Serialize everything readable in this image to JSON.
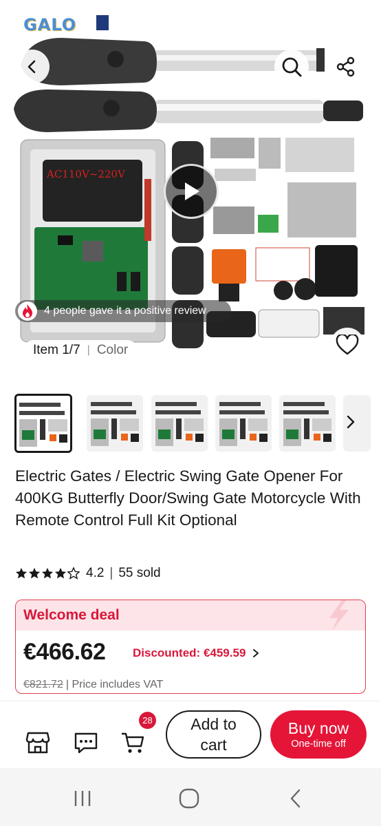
{
  "hero": {
    "brand_logo": "GALO",
    "image_text": "AC110V~220V",
    "review_text": "4 people gave it a positive review",
    "item_counter": "Item 1/7",
    "variant_label": "Color",
    "icons": [
      "back-icon",
      "search-icon",
      "share-icon",
      "play-icon",
      "fire-icon",
      "heart-icon"
    ]
  },
  "thumbnails": {
    "count_visible": 6,
    "active_index": 0
  },
  "product": {
    "title": "Electric Gates / Electric Swing Gate Opener For 400KG Butterfly Door/Swing Gate Motorcycle With Remote Control Full Kit Optional",
    "rating": "4.2",
    "rating_stars": 4.2,
    "sold": "55 sold"
  },
  "deal": {
    "label": "Welcome deal",
    "price": "€466.62",
    "discounted": "Discounted: €459.59",
    "original_price": "€821.72",
    "vat_note": "| Price includes VAT"
  },
  "actions": {
    "cart_count": "28",
    "add_to_cart_line1": "Add to",
    "add_to_cart_line2": "cart",
    "buy_now": "Buy now",
    "buy_now_sub": "One-time off"
  },
  "colors": {
    "accent_red": "#e51537",
    "deal_bg": "#fde4e8"
  }
}
